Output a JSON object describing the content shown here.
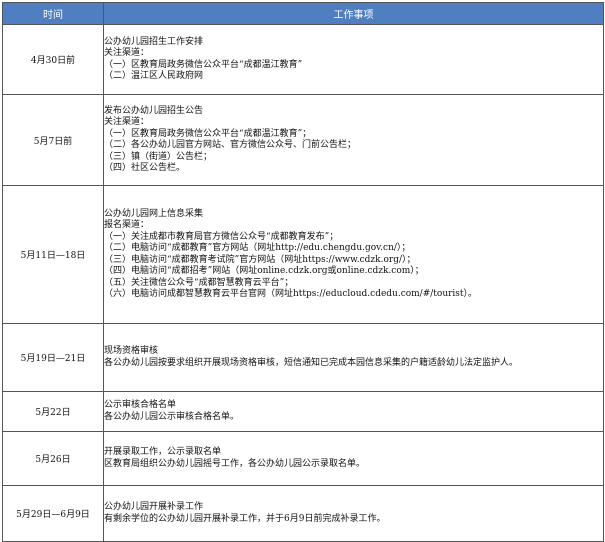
{
  "table": {
    "headers": [
      "时间",
      "工作事项"
    ],
    "rows": [
      {
        "date": "4月30日前",
        "lines": [
          "公办幼儿园招生工作安排",
          "关注渠道：",
          "（一）区教育局政务微信公众平台“成都温江教育”",
          "（二）温江区人民政府网"
        ]
      },
      {
        "date": "5月7日前",
        "lines": [
          "发布公办幼儿园招生公告",
          "关注渠道：",
          "（一）区教育局政务微信公众平台“成都温江教育”；",
          "（二）各公办幼儿园官方网站、官方微信公众号、门前公告栏；",
          "（三）镇（街道）公告栏；",
          "（四）社区公告栏。"
        ]
      },
      {
        "date": "5月11日—18日",
        "lines": [
          "公办幼儿园网上信息采集",
          "报名渠道：",
          "（一）关注成都市教育局官方微信公众号“成都教育发布”；",
          "（二）电脑访问“成都教育”官方网站（网址http://edu.chengdu.gov.cn/）；",
          "（三）电脑访问“成都教育考试院”官方网站（网址https://www.cdzk.org/）；",
          "（四）电脑访问“成都招考”网站（网址online.cdzk.org或online.cdzk.com）；",
          "（五）关注微信公众号“成都智慧教育云平台”；",
          "（六）电脑访问成都智慧教育云平台官网（网址https://educloud.cdedu.com/#/tourist）。"
        ]
      },
      {
        "date": "5月19日—21日",
        "lines": [
          "现场资格审核",
          "各公办幼儿园按要求组织开展现场资格审核，短信通知已完成本园信息采集的户籍适龄幼儿法定监护人。"
        ]
      },
      {
        "date": "5月22日",
        "lines": [
          "公示审核合格名单",
          "各公办幼儿园公示审核合格名单。"
        ]
      },
      {
        "date": "5月26日",
        "lines": [
          "开展录取工作，公示录取名单",
          "区教育局组织公办幼儿园摇号工作，各公办幼儿园公示录取名单。"
        ]
      },
      {
        "date": "5月29日—6月9日",
        "lines": [
          "公办幼儿园开展补录工作",
          "有剩余学位的公办幼儿园开展补录工作，并于6月9日前完成补录工作。"
        ]
      }
    ]
  }
}
